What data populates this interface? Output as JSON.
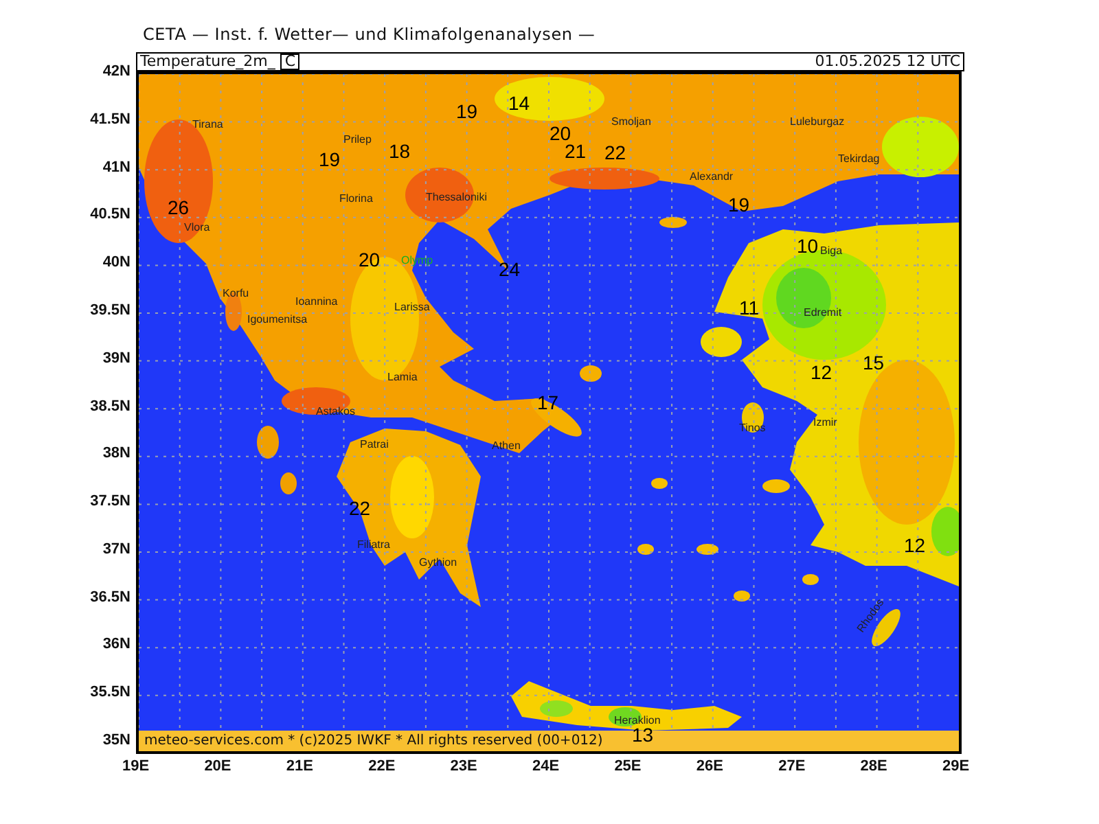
{
  "header": "CETA — Inst. f. Wetter— und Klimafolgenanalysen —",
  "panel": {
    "title": "Temperature_2m_",
    "unit": "C",
    "timestamp": "01.05.2025  12 UTC"
  },
  "lat_labels": [
    "42N",
    "41.5N",
    "41N",
    "40.5N",
    "40N",
    "39.5N",
    "39N",
    "38.5N",
    "38N",
    "37.5N",
    "37N",
    "36.5N",
    "36N",
    "35.5N",
    "35N"
  ],
  "lon_labels": [
    "19E",
    "20E",
    "21E",
    "22E",
    "23E",
    "24E",
    "25E",
    "26E",
    "27E",
    "28E",
    "29E"
  ],
  "cities": [
    {
      "name": "Tirana",
      "kind": "city"
    },
    {
      "name": "Prilep",
      "kind": "city"
    },
    {
      "name": "Florina",
      "kind": "city"
    },
    {
      "name": "Thessaloniki",
      "kind": "city"
    },
    {
      "name": "Vlora",
      "kind": "city"
    },
    {
      "name": "Korfu",
      "kind": "city"
    },
    {
      "name": "Ioannina",
      "kind": "city"
    },
    {
      "name": "Igoumenitsa",
      "kind": "city"
    },
    {
      "name": "Olymp",
      "kind": "peak"
    },
    {
      "name": "Larissa",
      "kind": "city"
    },
    {
      "name": "Lamia",
      "kind": "city"
    },
    {
      "name": "Astakos",
      "kind": "city"
    },
    {
      "name": "Patrai",
      "kind": "city"
    },
    {
      "name": "Athen",
      "kind": "city"
    },
    {
      "name": "Filiatra",
      "kind": "city"
    },
    {
      "name": "Gythion",
      "kind": "city"
    },
    {
      "name": "Smoljan",
      "kind": "city"
    },
    {
      "name": "Alexandr",
      "kind": "city"
    },
    {
      "name": "Luleburgaz",
      "kind": "city"
    },
    {
      "name": "Tekirdag",
      "kind": "city"
    },
    {
      "name": "Biga",
      "kind": "city"
    },
    {
      "name": "Edremit",
      "kind": "city"
    },
    {
      "name": "Tinos",
      "kind": "city"
    },
    {
      "name": "Izmir",
      "kind": "city"
    },
    {
      "name": "Rhodos",
      "kind": "city"
    },
    {
      "name": "Heraklion",
      "kind": "city"
    }
  ],
  "isotherm_labels": [
    "26",
    "19",
    "18",
    "19",
    "14",
    "20",
    "21",
    "22",
    "20",
    "24",
    "19",
    "10",
    "11",
    "12",
    "15",
    "17",
    "22",
    "12",
    "13"
  ],
  "copyright": "meteo-services.com * (c)2025 IWKF * All rights reserved (00+012)"
}
